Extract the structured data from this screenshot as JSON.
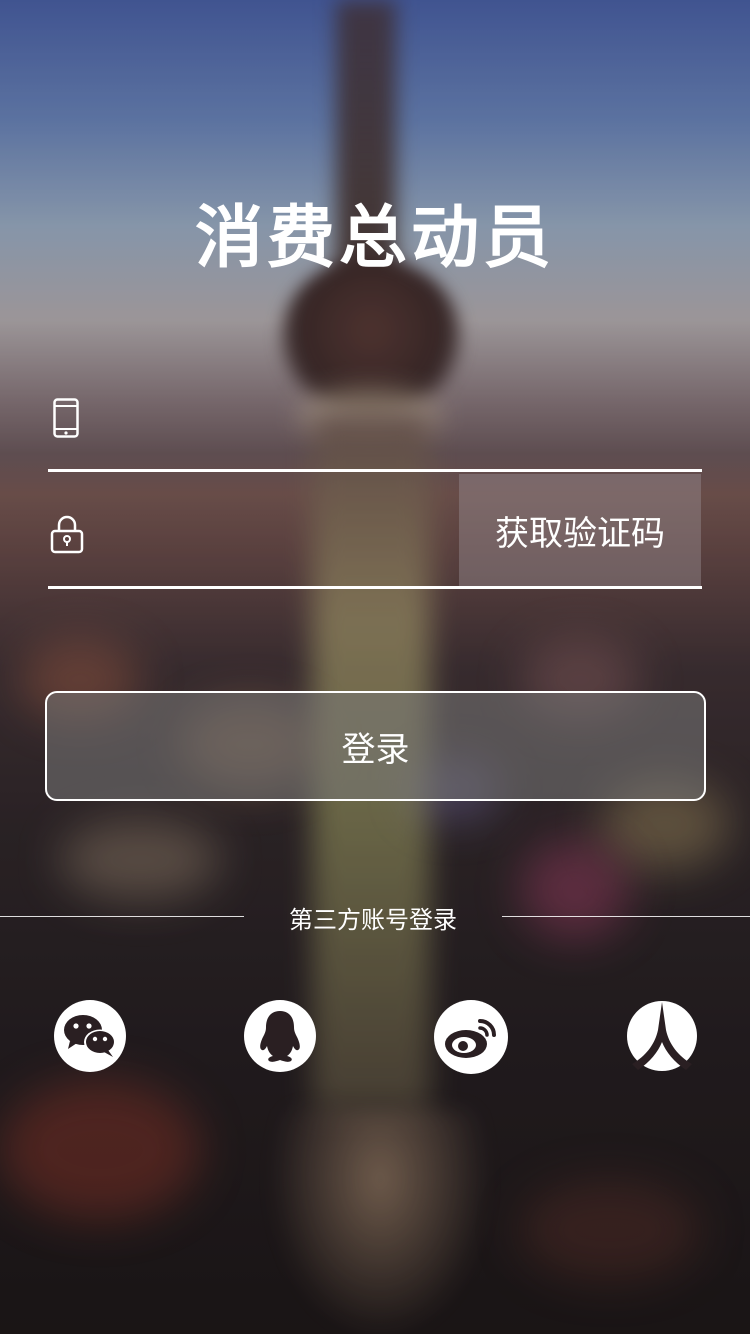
{
  "app": {
    "logo_text": "消费总动员"
  },
  "form": {
    "phone_placeholder": "",
    "code_placeholder": "",
    "get_code_label": "获取验证码",
    "login_label": "登录"
  },
  "third_party": {
    "label": "第三方账号登录",
    "providers": [
      {
        "name": "wechat",
        "icon": "wechat-icon"
      },
      {
        "name": "qq",
        "icon": "qq-icon"
      },
      {
        "name": "weibo",
        "icon": "weibo-icon"
      },
      {
        "name": "renren",
        "icon": "renren-icon"
      }
    ]
  },
  "colors": {
    "text": "#ffffff",
    "button_fill": "#787878",
    "icon_dark": "#2a1f22"
  }
}
